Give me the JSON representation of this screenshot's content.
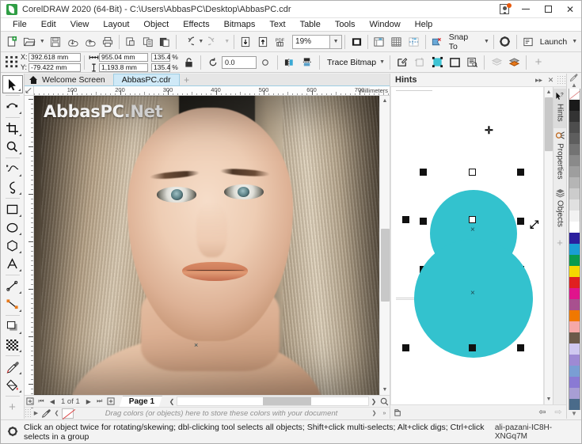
{
  "window": {
    "title": "CorelDRAW 2020 (64-Bit) - C:\\Users\\AbbasPC\\Desktop\\AbbasPC.cdr",
    "logo_icon": "coreldraw-logo-icon",
    "account_icon": "account-icon",
    "minimize": "minimize-icon",
    "maximize": "maximize-icon",
    "close": "close-icon"
  },
  "menubar": {
    "items": [
      "File",
      "Edit",
      "View",
      "Layout",
      "Object",
      "Effects",
      "Bitmaps",
      "Text",
      "Table",
      "Tools",
      "Window",
      "Help"
    ]
  },
  "toolbar": {
    "buttons": [
      "new-document-icon",
      "open-document-icon",
      "save-document-icon",
      "import-icon",
      "export-icon",
      "print-icon",
      "publish-pdf-icon",
      "copy-icon",
      "paste-icon",
      "undo-icon",
      "redo-icon",
      "import-file-icon",
      "export-file-icon",
      "export-pdf-icon"
    ],
    "zoom_value": "19%",
    "zoom_caret": "chevron-down-icon",
    "full_screen_preview": "full-screen-preview-icon",
    "show_rulers": "show-rulers-icon",
    "show_grid": "show-grid-icon",
    "show_guidelines": "show-guidelines-icon",
    "view_options": "view-options-icon",
    "snap_to_label": "Snap To",
    "snap_to_caret": "chevron-down-icon",
    "options_icon": "options-gear-icon",
    "launch_label": "Launch",
    "launch_icon": "launch-icon",
    "launch_caret": "chevron-down-icon"
  },
  "propbar": {
    "object_position_icon": "object-position-icon",
    "x_label": "X:",
    "x_value": "392.618 mm",
    "y_label": "Y:",
    "y_value": "-79.422 mm",
    "width_icon": "object-width-icon",
    "width_value": "955.04 mm",
    "height_icon": "object-height-icon",
    "height_value": "1,193.8 mm",
    "scale_w": "135.4",
    "scale_h": "135.4",
    "percent_symbol": "%",
    "lock_ratio_icon": "lock-ratio-icon",
    "rotate_icon": "rotation-angle-icon",
    "rotation_value": "0.0",
    "mirror_icon": "mirror-icon",
    "mirror_h_icon": "mirror-horizontal-icon",
    "mirror_v_icon": "mirror-vertical-icon",
    "trace_bitmap_label": "Trace Bitmap",
    "trace_caret": "chevron-down-icon",
    "edit_bitmap_icon": "edit-bitmap-icon",
    "crop_bitmap_icon": "crop-bitmap-icon",
    "resample_icon": "resample-bitmap-icon",
    "bitmap_border_icon": "bitmap-border-icon",
    "document_properties_icon": "document-properties-icon",
    "layer_back_icon": "layer-back-icon",
    "layer_front_icon": "layer-front-icon",
    "add_icon": "add-icon"
  },
  "toolbox": {
    "tools": [
      {
        "name": "pick-tool",
        "icon": "arrow-cursor-icon",
        "selected": true
      },
      {
        "name": "shape-tool",
        "icon": "node-edit-icon",
        "selected": false
      },
      {
        "name": "crop-tool",
        "icon": "crop-icon",
        "selected": false
      },
      {
        "name": "zoom-tool",
        "icon": "magnifier-icon",
        "selected": false
      },
      {
        "name": "freehand-tool",
        "icon": "freehand-pen-icon",
        "selected": false
      },
      {
        "name": "artistic-media-tool",
        "icon": "artistic-media-icon",
        "selected": false
      },
      {
        "name": "rectangle-tool",
        "icon": "rectangle-icon",
        "selected": false
      },
      {
        "name": "ellipse-tool",
        "icon": "ellipse-icon",
        "selected": false
      },
      {
        "name": "polygon-tool",
        "icon": "polygon-icon",
        "selected": false
      },
      {
        "name": "text-tool",
        "icon": "text-a-icon",
        "selected": false
      },
      {
        "name": "dimension-tool",
        "icon": "dimension-line-icon",
        "selected": false
      },
      {
        "name": "connector-tool",
        "icon": "connector-icon",
        "selected": false
      },
      {
        "name": "drop-shadow-tool",
        "icon": "drop-shadow-icon",
        "selected": false
      },
      {
        "name": "transparency-tool",
        "icon": "transparency-checker-icon",
        "selected": false
      },
      {
        "name": "color-eyedropper-tool",
        "icon": "eyedropper-icon",
        "selected": false
      },
      {
        "name": "interactive-fill-tool",
        "icon": "fill-bucket-icon",
        "selected": false
      },
      {
        "name": "add-tool",
        "icon": "plus-icon",
        "selected": false
      }
    ]
  },
  "tabs": {
    "home_icon": "home-icon",
    "items": [
      {
        "label": "Welcome Screen",
        "active": false
      },
      {
        "label": "AbbasPC.cdr",
        "active": true
      }
    ],
    "add_tab_icon": "plus-icon"
  },
  "ruler": {
    "unit_label": "millimeters",
    "h_ticks": [
      "100",
      "200",
      "300",
      "400",
      "500",
      "600",
      "700"
    ],
    "origin_icon": "ruler-origin-icon"
  },
  "canvas": {
    "watermark_bold": "AbbasPC",
    "watermark_rest": ".Net",
    "center_marker": "×",
    "image_description": "portrait-photo"
  },
  "pagebar": {
    "first_icon": "go-first-icon",
    "prev_icon": "go-previous-icon",
    "counter": "1 of 1",
    "next_icon": "go-next-icon",
    "last_icon": "go-last-icon",
    "add_page_start_icon": "add-page-before-icon",
    "add_page_end_icon": "add-page-after-icon",
    "page_label": "Page 1",
    "zoom_icon": "zoom-to-fit-icon"
  },
  "palette_bar": {
    "handle_icon": "drag-handle-icon",
    "arrow_icon": "chevron-right-icon",
    "eyedropper_icon": "eyedropper-icon",
    "nofill_icon": "no-fill-swatch-icon",
    "hint": "Drag colors (or objects) here to store these colors with your document",
    "scroll_right_icon": "chevron-right-icon",
    "expand_icon": "double-chevron-right-icon"
  },
  "docker": {
    "title": "Hints",
    "collapse_icon": "collapse-docker-icon",
    "close_icon": "close-icon",
    "grip_icon": "grip-dots-icon",
    "tabs": [
      {
        "label": "Hints",
        "icon": "hints-cursor-question-icon",
        "active": true
      },
      {
        "label": "Properties",
        "icon": "properties-icon",
        "active": false
      },
      {
        "label": "Objects",
        "icon": "objects-layers-icon",
        "active": false
      }
    ],
    "add_docker_icon": "plus-icon",
    "back_icon": "back-arrow-icon",
    "forward_icon": "forward-arrow-icon",
    "home_icon": "hint-home-icon",
    "shape_color": "#33C2CE",
    "shapes": [
      {
        "name": "circle-top",
        "selected": true
      },
      {
        "name": "circle-bottom",
        "selected": true
      }
    ],
    "move_cursor_icon": "move-cursor-icon",
    "resize_cursor_icon": "resize-diagonal-cursor-icon"
  },
  "color_palette": {
    "top_icon": "eyedropper-icon",
    "scroll_up_icon": "chevron-up-icon",
    "scroll_down_icon": "chevron-down-icon",
    "expand_icon": "double-chevron-right-icon",
    "swatches": [
      "#ffffff",
      "#1a1a1a",
      "#333333",
      "#4d4d4d",
      "#5e5e5e",
      "#737373",
      "#8a8a8a",
      "#9e9e9e",
      "#b5b5b5",
      "#cccccc",
      "#e0e0e0",
      "#f2f2f2",
      "#ffffff",
      "#2b1f9e",
      "#1a9ed4",
      "#0a9b4e",
      "#f5d800",
      "#e02020",
      "#e0148c",
      "#a8508f",
      "#f07800",
      "#f5a8a8",
      "#6b5a4a",
      "#cfc8f0",
      "#9e8ad4",
      "#7a9ed4",
      "#8a7ad4",
      "#a89ed4",
      "#4a6b8a"
    ]
  },
  "statusbar": {
    "gear_icon": "status-gear-icon",
    "message": "Click an object twice for rotating/skewing; dbl-clicking tool selects all objects; Shift+click multi-selects; Alt+click digs; Ctrl+click selects in a group",
    "right_text": "ali-pazani-IC8H-XNGq7M"
  }
}
